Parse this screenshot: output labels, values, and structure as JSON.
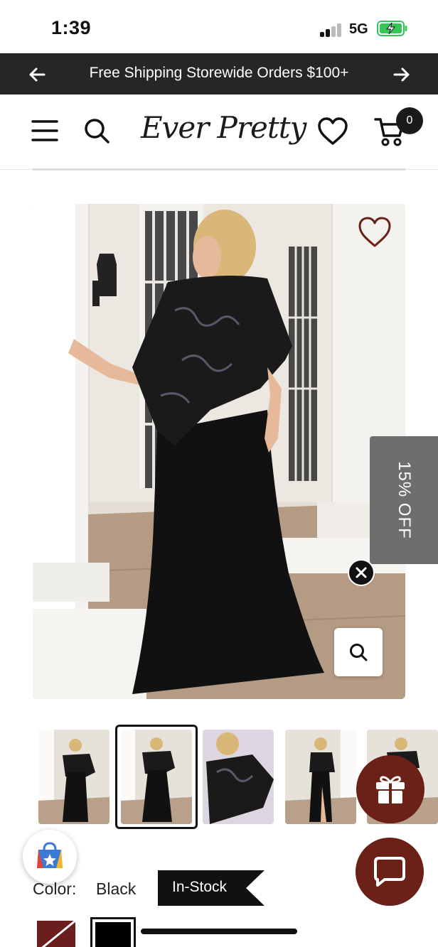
{
  "status_bar": {
    "time": "1:39",
    "network": "5G",
    "icons": [
      "signal-icon",
      "battery-charging-icon"
    ]
  },
  "announcement": {
    "text": "Free Shipping Storewide Orders $100+",
    "icons": [
      "arrow-left-icon",
      "arrow-right-icon"
    ]
  },
  "header": {
    "logo": "Ever Pretty",
    "cart_count": "0",
    "icons": [
      "menu-icon",
      "search-icon",
      "heart-icon",
      "cart-icon"
    ]
  },
  "product": {
    "image_alt": "black maxi dress with sequin cape",
    "discount_tab": "15% OFF",
    "thumbnail_count": 5,
    "selected_thumbnail": 2
  },
  "options": {
    "color_label": "Color:",
    "color_value": "Black",
    "stock_label": "In-Stock"
  },
  "colors": {
    "announce_bg": "#262626",
    "accent": "#6b2118",
    "discount_tab_bg": "#6e6e6e"
  }
}
